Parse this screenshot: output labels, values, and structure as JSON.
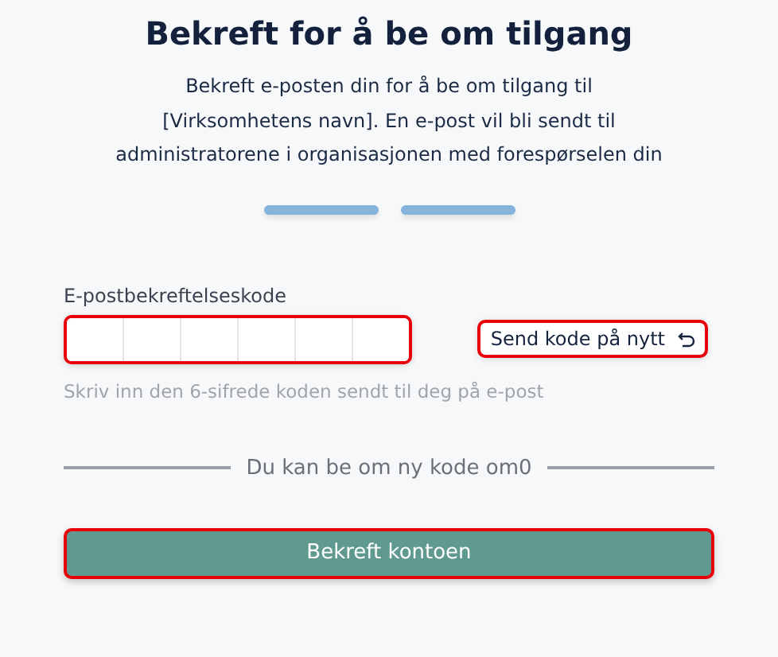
{
  "title": "Bekreft for å be om tilgang",
  "description": "Bekreft e-posten din for å be om tilgang til [Virksomhetens navn]. En e-post vil bli sendt til administratorene i organisasjonen med forespørselen din",
  "progress_steps": [
    {
      "done": true
    },
    {
      "done": true
    }
  ],
  "code_field": {
    "label": "E-postbekreftelseskode",
    "highlighted": true,
    "hint": "Skriv inn den 6-sifrede koden sendt til deg på e-post"
  },
  "resend_button": {
    "label": "Send kode på nytt",
    "highlighted": true
  },
  "divider_text": "Du kan be om ny kode om0",
  "submit_button": {
    "label": "Bekreft kontoen",
    "highlighted": true
  }
}
